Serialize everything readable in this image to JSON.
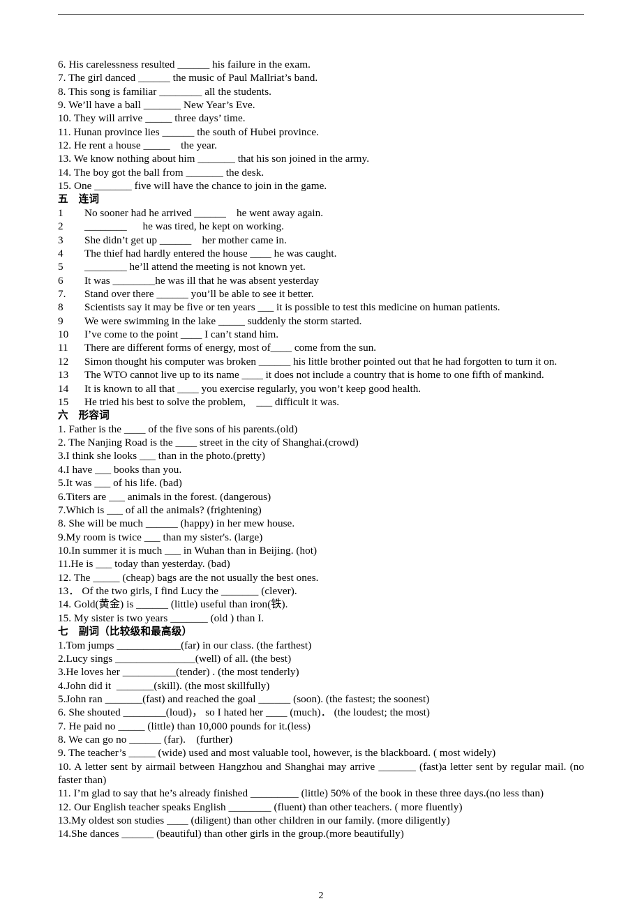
{
  "page": {
    "number": "2",
    "header_rule": true
  },
  "prepositions_section": {
    "items": [
      "6. His carelessness resulted ______ his failure in the exam.",
      "7. The girl danced ______ the music of Paul Mallriat’s band.",
      "8. This song is familiar ________ all the students.",
      "9. We’ll have a ball _______ New Year’s Eve.",
      "10. They will arrive _____ three days’ time.",
      "11. Hunan province lies ______ the south of Hubei province.",
      "12. He rent a house _____    the year.",
      "13. We know nothing about him _______ that his son joined in the army.",
      "14. The boy got the ball from _______ the desk.",
      "15. One _______ five will have the chance to join in the game."
    ]
  },
  "conjunctions_section": {
    "heading": "五　连词",
    "items": [
      {
        "num": "1",
        "text": "No sooner had he arrived ______    he went away again."
      },
      {
        "num": "2",
        "text": "________      he was tired, he kept on working."
      },
      {
        "num": "3",
        "text": "She didn’t get up ______    her mother came in."
      },
      {
        "num": "4",
        "text": "The thief had hardly entered the house ____ he was caught."
      },
      {
        "num": "5",
        "text": "________ he’ll attend the meeting is not known yet."
      },
      {
        "num": "6",
        "text": "It was ________he was ill that he was absent yesterday"
      },
      {
        "num": "7.",
        "text": "Stand over there ______ you’ll be able to see it better."
      },
      {
        "num": "8",
        "text": "Scientists say it may be five or ten years ___ it is possible to test this medicine on human patients."
      },
      {
        "num": "9",
        "text": "We were swimming in the lake _____ suddenly the storm started."
      },
      {
        "num": "10",
        "text": "I’ve come to the point ____ I can’t stand him."
      },
      {
        "num": "11",
        "text": "There are different forms of energy, most of____ come from the sun."
      },
      {
        "num": "12",
        "text": "Simon thought his computer was broken ______ his little brother pointed out that he had forgotten to turn it on."
      },
      {
        "num": "13",
        "text": "The WTO cannot live up to its name ____ it does not include a country that is home to one fifth of mankind."
      },
      {
        "num": "14",
        "text": "It is known to all that ____ you exercise regularly, you won’t keep good health."
      },
      {
        "num": "15",
        "text": "He tried his best to solve the problem,    ___ difficult it was."
      }
    ]
  },
  "adjectives_section": {
    "heading": "六　形容词",
    "items": [
      "1. Father is the ____ of the five sons of his parents.(old)",
      "2. The Nanjing Road is the ____ street in the city of Shanghai.(crowd)",
      "3.I think she looks ___ than in the photo.(pretty)",
      "4.I have ___ books than you.",
      "5.It was ___ of his life. (bad)",
      "6.Titers are ___ animals in the forest. (dangerous)",
      "7.Which is ___ of all the animals? (frightening)",
      "8. She will be much ______ (happy) in her mew house.",
      "9.My room is twice ___ than my sister's. (large)",
      "10.In summer it is much ___ in Wuhan than in Beijing. (hot)",
      "11.He is ___ today than yesterday. (bad)",
      "12. The _____ (cheap) bags are the not usually the best ones.",
      "13． Of the two girls, I find Lucy the _______ (clever).",
      "14. Gold(黄金) is ______ (little) useful than iron(铁).",
      "15. My sister is two years _______ (old ) than I."
    ]
  },
  "adverbs_section": {
    "heading": "七　副词（比较级和最高级）",
    "items": [
      "1.Tom jumps ____________(far) in our class. (the farthest)",
      "2.Lucy sings _______________(well) of all. (the best)",
      "3.He loves her __________(tender) . (the most tenderly)",
      "4.John did it  _______(skill). (the most skillfully)",
      "5.John ran _______(fast) and reached the goal ______ (soon). (the fastest; the soonest)",
      "6. She shouted ________(loud)， so I hated her ____ (much)． (the loudest; the most)",
      "7. He paid no _____ (little) than 10,000 pounds for it.(less)",
      "8. We can go no ______ (far).    (further)",
      "9. The teacher’s _____ (wide) used and most valuable tool, however, is the blackboard. ( most widely)",
      "10. A letter sent by airmail between Hangzhou and Shanghai may arrive _______ (fast)a letter sent by regular mail. (no faster than)",
      "11. I’m glad to say that he’s already finished _________ (little) 50% of the book in these three days.(no less than)",
      "12. Our English teacher speaks English ________ (fluent) than other teachers. ( more fluently)",
      "13.My oldest son studies ____ (diligent) than other children in our family. (more diligently)",
      "14.She dances ______ (beautiful) than other girls in the group.(more beautifully)"
    ]
  }
}
